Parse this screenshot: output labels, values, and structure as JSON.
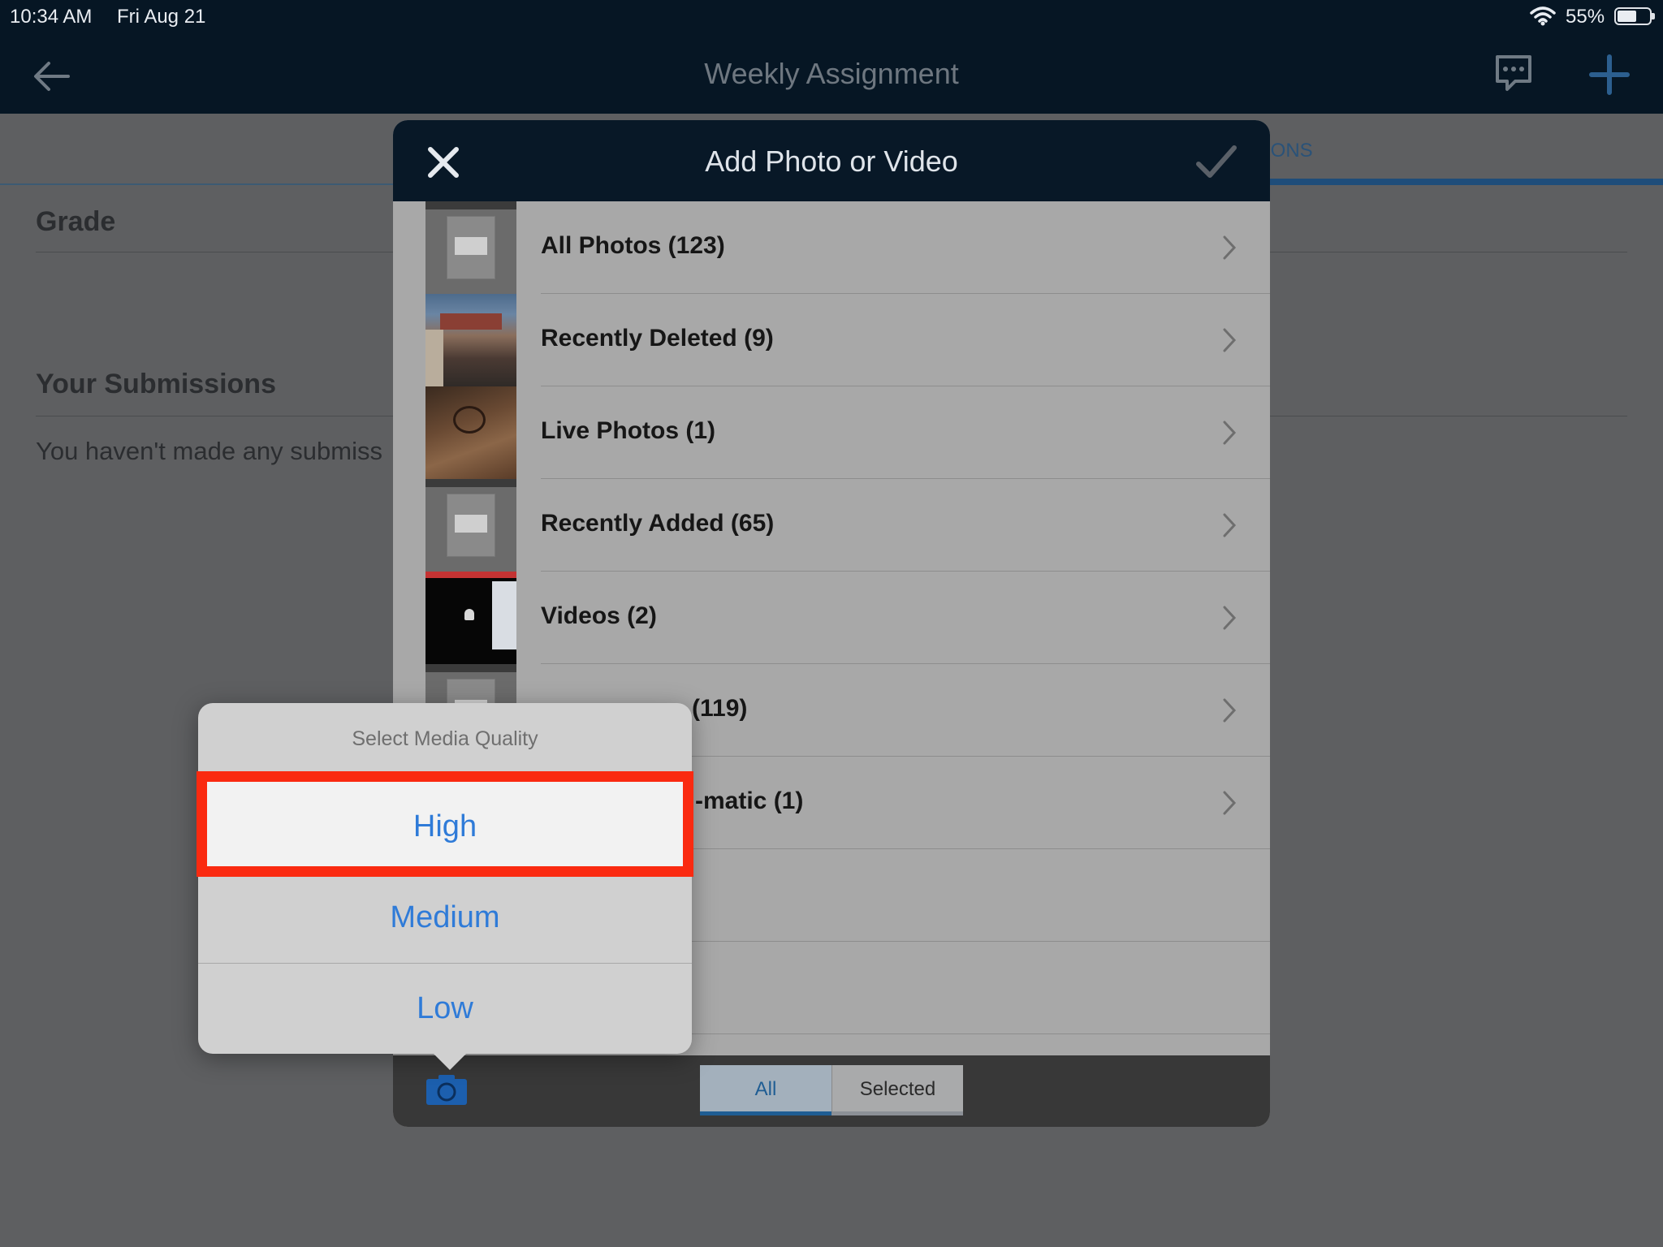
{
  "status_bar": {
    "time": "10:34 AM",
    "date": "Fri Aug 21",
    "battery": "55%",
    "battery_level": 0.55
  },
  "nav": {
    "title": "Weekly Assignment",
    "back_icon": "back-arrow-icon",
    "message_icon": "message-bubble-icon",
    "add_icon": "plus-icon"
  },
  "tabs": {
    "visible_tab_fragment": "IONS"
  },
  "page": {
    "grade_title": "Grade",
    "submissions_title": "Your Submissions",
    "submissions_empty": "You haven't made any submiss"
  },
  "modal": {
    "title": "Add Photo or Video",
    "close_icon": "close-icon",
    "confirm_icon": "checkmark-icon",
    "albums": [
      {
        "label": "All Photos (123)",
        "thumb": "screenshot-gray"
      },
      {
        "label": "Recently Deleted (9)",
        "thumb": "building-photo"
      },
      {
        "label": "Live Photos (1)",
        "thumb": "floor-photo"
      },
      {
        "label": "Recently Added (65)",
        "thumb": "screenshot-gray"
      },
      {
        "label": "Videos (2)",
        "thumb": "black-video"
      },
      {
        "label": "(119)",
        "thumb": "screenshot-gray"
      },
      {
        "label": "-matic (1)",
        "thumb": ""
      },
      {
        "label": "",
        "thumb": ""
      },
      {
        "label": "",
        "thumb": ""
      }
    ],
    "footer": {
      "camera_icon": "camera-icon",
      "segment_all": "All",
      "segment_selected": "Selected",
      "active_segment": "All"
    }
  },
  "popover": {
    "title": "Select Media Quality",
    "options": [
      "High",
      "Medium",
      "Low"
    ],
    "highlighted_option": "High",
    "highlight_color": "#fa2a10",
    "option_color": "#2f7bd8"
  }
}
